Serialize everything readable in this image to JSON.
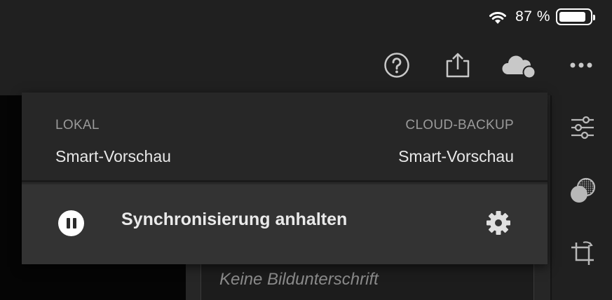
{
  "status_bar": {
    "battery_percent": "87 %",
    "battery_level": 0.87,
    "icons": [
      "wifi-icon",
      "battery-icon"
    ]
  },
  "toolbar": {
    "icons": [
      "help-icon",
      "share-icon",
      "cloud-sync-icon",
      "more-icon"
    ]
  },
  "sync_popover": {
    "local_label": "LOKAL",
    "local_value": "Smart-Vorschau",
    "cloud_label": "CLOUD-BACKUP",
    "cloud_value": "Smart-Vorschau",
    "pause_sync_label": "Synchronisierung anhalten",
    "icons": [
      "pause-icon",
      "settings-gear-icon"
    ]
  },
  "editor": {
    "caption_placeholder": "Keine Bildunterschrift"
  },
  "right_panel": {
    "icons": [
      "adjust-sliders-icon",
      "presets-icon",
      "crop-rotate-icon"
    ]
  },
  "colors": {
    "background": "#1e1e1e",
    "header": "#202020",
    "popover": "#282828",
    "popover_row": "#333333",
    "text_primary": "#e8e8e8",
    "text_secondary": "#9a9a9a"
  }
}
